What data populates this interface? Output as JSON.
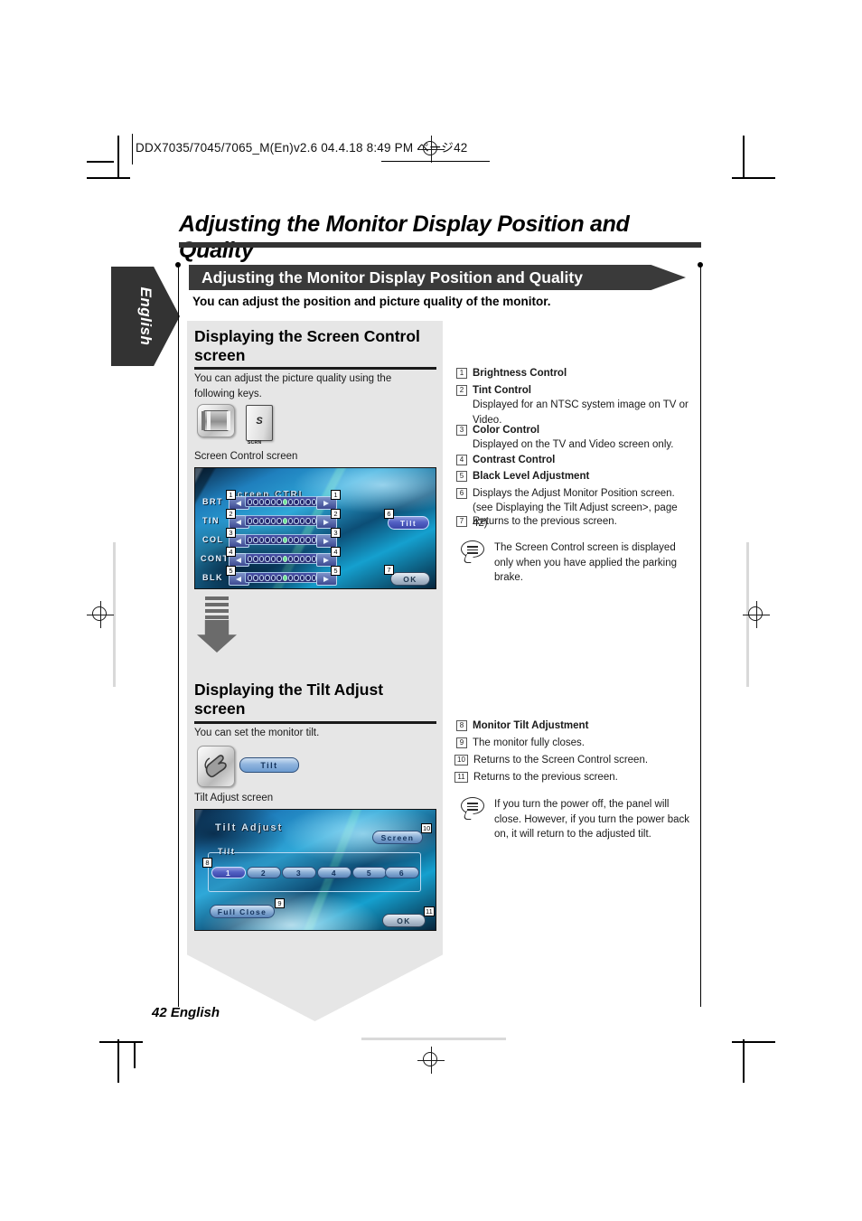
{
  "page_header": {
    "file_info": "DDX7035/7045/7065_M(En)v2.6   04.4.18   8:49 PM   ページ42"
  },
  "title": {
    "main": "Adjusting the Monitor Display Position and Quality",
    "banner": "Adjusting the Monitor Display Position and Quality",
    "lead": "You can adjust the position and picture quality of the monitor."
  },
  "side_tab": {
    "label": "English"
  },
  "section1": {
    "heading": "Displaying the Screen Control screen",
    "intro": "You can adjust the picture quality using the following keys.",
    "keys": [
      {
        "name": "screen-key-icon",
        "label": ""
      },
      {
        "name": "scrn-key-icon",
        "glyph": "S",
        "label": "SCRN"
      }
    ],
    "caption": "Screen Control screen",
    "screen": {
      "title": "Screen CTRL",
      "rows": [
        {
          "label": "BRT",
          "dots": 12,
          "active_index": 6,
          "callout_left": "1",
          "callout_right": "1"
        },
        {
          "label": "TIN",
          "dots": 12,
          "active_index": 6,
          "callout_left": "2",
          "callout_right": "2"
        },
        {
          "label": "COL",
          "dots": 12,
          "active_index": 6,
          "callout_left": "3",
          "callout_right": "3"
        },
        {
          "label": "CONT",
          "dots": 12,
          "active_index": 6,
          "callout_left": "4",
          "callout_right": "4"
        },
        {
          "label": "BLK",
          "dots": 12,
          "active_index": 6,
          "callout_left": "5",
          "callout_right": "5"
        }
      ],
      "tilt_button": "Tilt",
      "tilt_callout": "6",
      "ok_button": "OK",
      "ok_callout": "7"
    }
  },
  "section2": {
    "heading": "Displaying the Tilt Adjust screen",
    "intro": "You can set the monitor tilt.",
    "keys": [
      {
        "name": "hand-key-icon"
      },
      {
        "name": "tilt-touch-button",
        "label": "Tilt"
      }
    ],
    "caption": "Tilt Adjust screen",
    "screen": {
      "title": "Tilt Adjust",
      "screen_button": "Screen",
      "screen_callout": "10",
      "group_label": "Tilt",
      "group_callout": "8",
      "steps": [
        "1",
        "2",
        "3",
        "4",
        "5",
        "6"
      ],
      "selected_step": "1",
      "full_close_button": "Full Close",
      "full_close_callout": "9",
      "ok_button": "OK",
      "ok_callout": "11"
    }
  },
  "legend_top": [
    {
      "num": "1",
      "title": "Brightness Control",
      "desc": ""
    },
    {
      "num": "2",
      "title": "Tint Control",
      "desc": "Displayed for an NTSC system image on TV or Video."
    },
    {
      "num": "3",
      "title": "Color Control",
      "desc": "Displayed on the TV and Video screen only."
    },
    {
      "num": "4",
      "title": "Contrast Control",
      "desc": ""
    },
    {
      "num": "5",
      "title": "Black Level Adjustment",
      "desc": ""
    },
    {
      "num": "6",
      "title": "",
      "desc": "Displays the Adjust Monitor Position screen. (see   Displaying the Tilt Adjust screen>, page 42)"
    },
    {
      "num": "7",
      "title": "",
      "desc": "Returns to the previous screen."
    }
  ],
  "note_top": "The Screen Control screen is displayed only when you have applied the parking brake.",
  "legend_bottom": [
    {
      "num": "8",
      "title": "Monitor Tilt Adjustment",
      "desc": ""
    },
    {
      "num": "9",
      "title": "",
      "desc": "The monitor fully closes."
    },
    {
      "num": "10",
      "title": "",
      "desc": "Returns to the Screen Control screen."
    },
    {
      "num": "11",
      "title": "",
      "desc": "Returns to the previous screen."
    }
  ],
  "note_bottom": "If you turn the power off, the panel will close. However, if you turn the power back on, it will return to the adjusted tilt.",
  "footer": {
    "page": "42 English"
  }
}
